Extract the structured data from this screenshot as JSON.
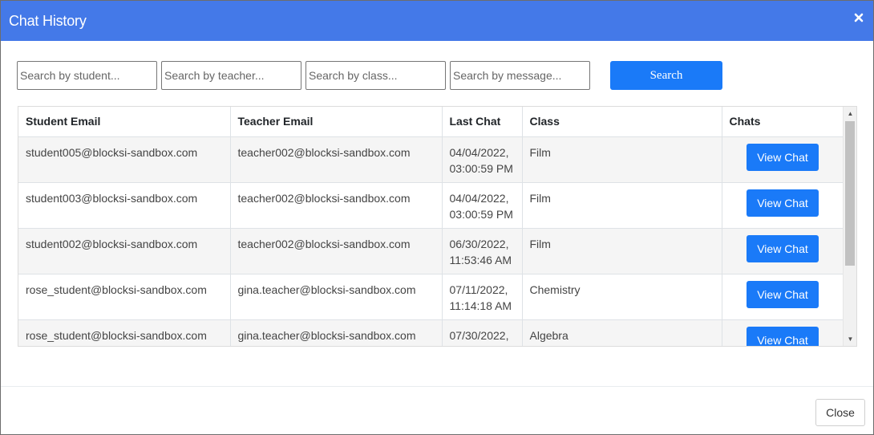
{
  "dialog": {
    "title": "Chat History",
    "close_icon": "times-icon"
  },
  "search": {
    "student_placeholder": "Search by student...",
    "teacher_placeholder": "Search by teacher...",
    "class_placeholder": "Search by class...",
    "message_placeholder": "Search by message...",
    "button_label": "Search"
  },
  "table": {
    "headers": [
      "Student Email",
      "Teacher Email",
      "Last Chat",
      "Class",
      "Chats"
    ],
    "rows": [
      {
        "student": "student005@blocksi-sandbox.com",
        "teacher": "teacher002@blocksi-sandbox.com",
        "date": "04/04/2022,",
        "time": "03:00:59 PM",
        "class": "Film",
        "action": "View Chat"
      },
      {
        "student": "student003@blocksi-sandbox.com",
        "teacher": "teacher002@blocksi-sandbox.com",
        "date": "04/04/2022,",
        "time": "03:00:59 PM",
        "class": "Film",
        "action": "View Chat"
      },
      {
        "student": "student002@blocksi-sandbox.com",
        "teacher": "teacher002@blocksi-sandbox.com",
        "date": "06/30/2022,",
        "time": "11:53:46 AM",
        "class": "Film",
        "action": "View Chat"
      },
      {
        "student": "rose_student@blocksi-sandbox.com",
        "teacher": "gina.teacher@blocksi-sandbox.com",
        "date": "07/11/2022,",
        "time": "11:14:18 AM",
        "class": "Chemistry",
        "action": "View Chat"
      },
      {
        "student": "rose_student@blocksi-sandbox.com",
        "teacher": "gina.teacher@blocksi-sandbox.com",
        "date": "07/30/2022,",
        "time": "",
        "class": "Algebra",
        "action": "View Chat"
      }
    ]
  },
  "footer": {
    "close_label": "Close"
  },
  "colors": {
    "header_bg": "#4479e8",
    "primary_button": "#1a7af8"
  }
}
